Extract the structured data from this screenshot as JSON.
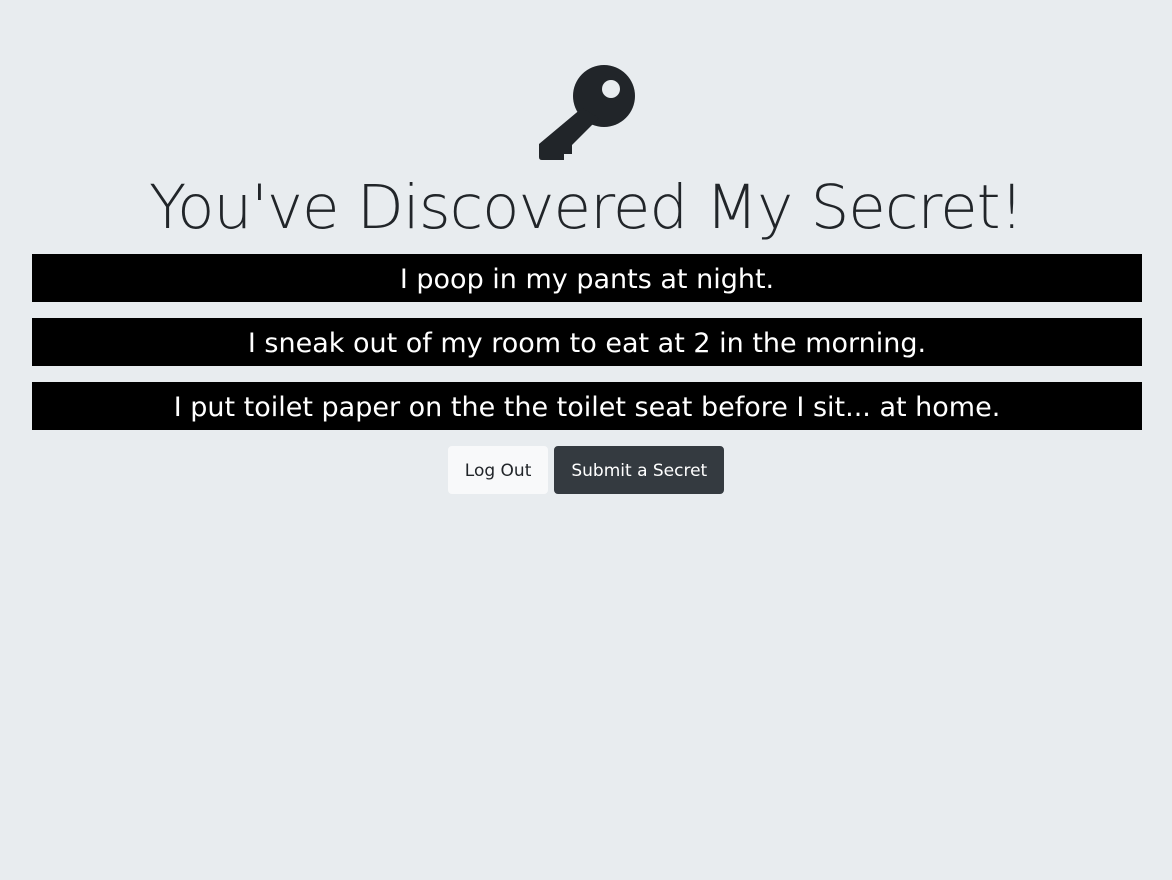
{
  "header": {
    "icon": "key-icon",
    "title": "You've Discovered My Secret!"
  },
  "secrets": [
    "I poop in my pants at night.",
    "I sneak out of my room to eat at 2 in the morning.",
    "I put toilet paper on the the toilet seat before I sit... at home."
  ],
  "actions": {
    "logout_label": "Log Out",
    "submit_label": "Submit a Secret"
  },
  "colors": {
    "background": "#e8ecef",
    "secret_bg": "#000000",
    "secret_text": "#ffffff",
    "title_text": "#212529",
    "btn_light": "#f8f9fa",
    "btn_dark": "#343a40"
  }
}
